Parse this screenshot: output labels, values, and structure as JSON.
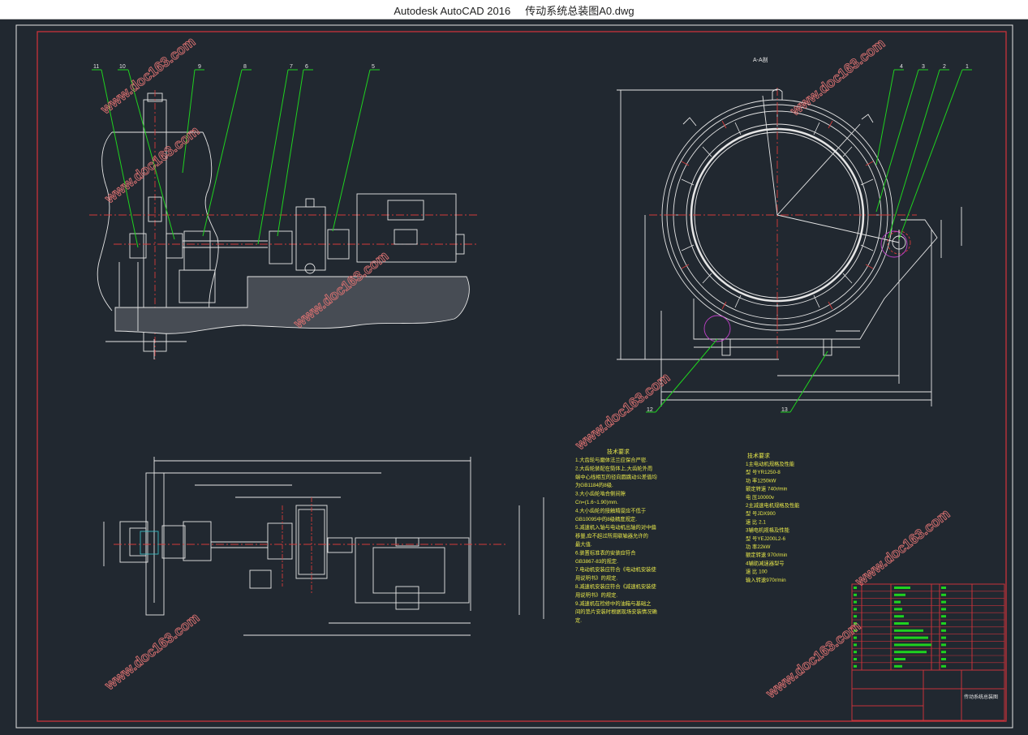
{
  "window": {
    "app": "Autodesk AutoCAD 2016",
    "file": "传动系统总装图A0.dwg"
  },
  "colors": {
    "background": "#212830",
    "frame": "#c8323a",
    "geometry": "#e6e6e6",
    "leader": "#1fd21f",
    "center": "#d43a3a",
    "note": "#e8e84a",
    "marker": "#c040c8"
  },
  "drawing": {
    "section_label": "A-A剖",
    "balloons_side": [
      "11",
      "10",
      "9",
      "8",
      "7",
      "6",
      "5"
    ],
    "balloons_section": [
      "4",
      "3",
      "2",
      "1"
    ],
    "balloons_bottom": [
      "12",
      "13"
    ]
  },
  "tech_requirements": {
    "title": "技术要求",
    "lines": [
      "1.大齿轮与磨体法兰应保合严密.",
      "2.大齿轮装配在筒体上,大齿轮外周",
      "端中心线相互的径向圆跳动公差值均",
      "为GB1184的8级.",
      "3.大小齿轮啮合侧间隙",
      "Cn=(1.6~1.90)mm.",
      "4.大小齿轮的接触精度应不低于",
      "GB10095中的8级精度规定.",
      "5.减速机入轴与电动机出轴的对中偏",
      "移量,应不超过所用联轴器允许的",
      "最大值.",
      "6.装置标准表的安装应符合",
      "GB3867-83的规定.",
      "7.电动机安装应符合《电动机安装使",
      "用说明书》的规定.",
      "8.减速机安装应符合《减速机安装使",
      "用说明书》的规定.",
      "9.减速机在检修中的油箱与基础之",
      "间的垫片安装时根据现场安装情况确",
      "定."
    ]
  },
  "tech_performance": {
    "title": "技术要求",
    "lines": [
      "1主电动机规格及性能",
      "  型  号YR1250-8",
      "  功  率1250kW",
      "  额定转速 740r/min",
      "  电  压10000v",
      "2主减速电机规格及性能",
      "  型  号JDX900",
      "  速  比  2.1",
      "3辅电机规格及性能",
      "  型  号YEJ200L2-6",
      "  功  率22kW",
      "  额定转速 970r/min",
      "4辅助减速器型号",
      "  速  比 100",
      "  输入转速970r/min"
    ]
  },
  "title_block": {
    "drawing_name": "传动系统总装图"
  },
  "watermark": "www.doc163.com"
}
